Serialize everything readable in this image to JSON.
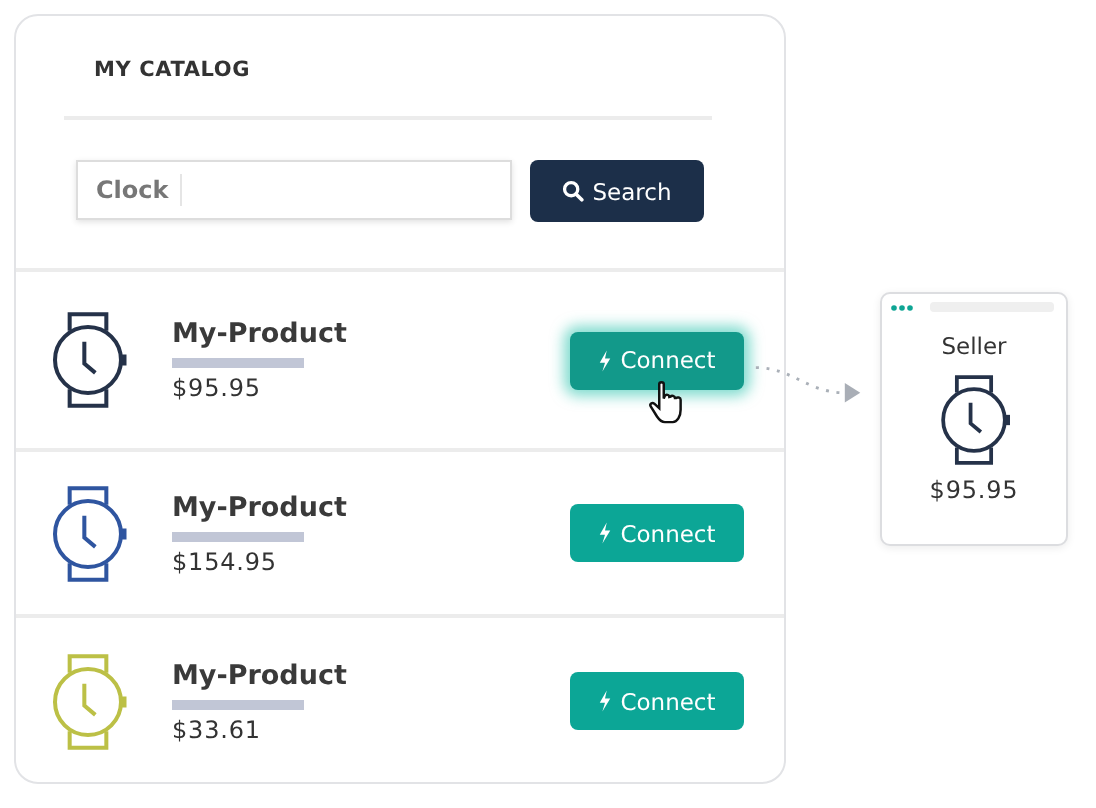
{
  "catalog": {
    "title": "MY CATALOG",
    "search": {
      "scope": "Clock",
      "button": "Search"
    },
    "products": [
      {
        "name": "My-Product",
        "price": "$95.95",
        "color": "#253249",
        "button": "Connect",
        "hovered": true
      },
      {
        "name": "My-Product",
        "price": "$154.95",
        "color": "#2f55a0",
        "button": "Connect",
        "hovered": false
      },
      {
        "name": "My-Product",
        "price": "$33.61",
        "color": "#bcc046",
        "button": "Connect",
        "hovered": false
      }
    ]
  },
  "seller": {
    "title": "Seller",
    "price": "$95.95",
    "color": "#253249"
  }
}
